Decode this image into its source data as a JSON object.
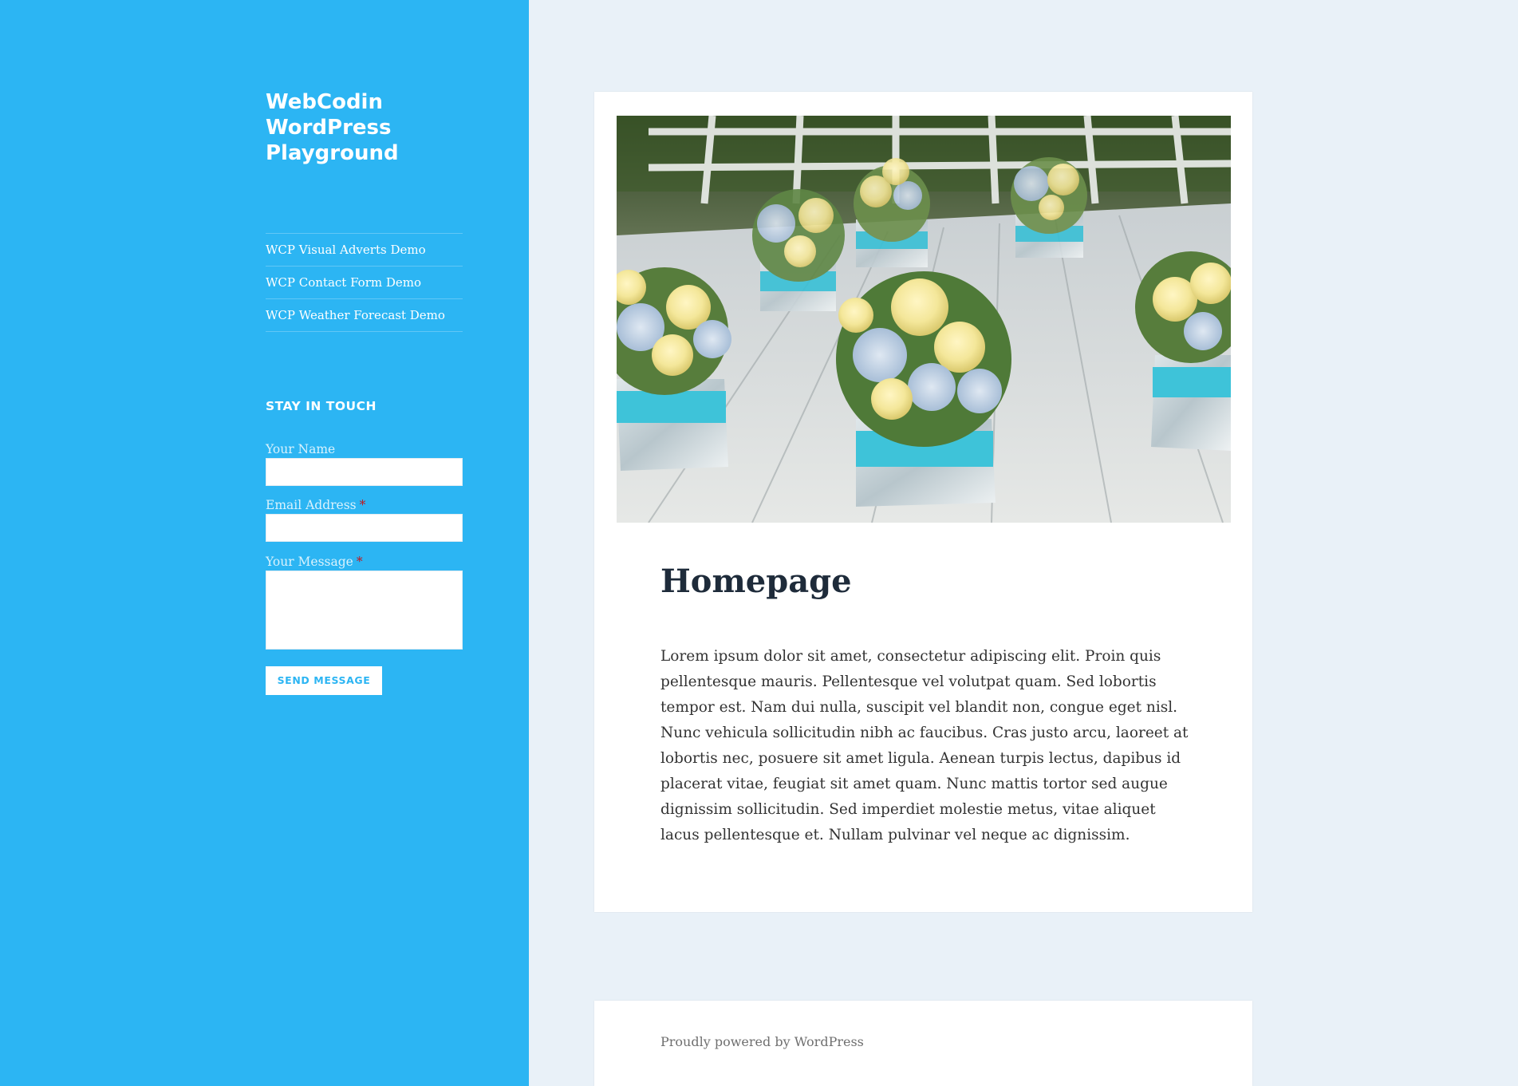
{
  "site": {
    "title_line1": "WebCodin",
    "title_line2": "WordPress",
    "title_line3": "Playground"
  },
  "nav": {
    "items": [
      {
        "label": "WCP Visual Adverts Demo"
      },
      {
        "label": "WCP Contact Form Demo"
      },
      {
        "label": "WCP Weather Forecast Demo"
      }
    ]
  },
  "contact_widget": {
    "title": "Stay in Touch",
    "name_label": "Your Name",
    "email_label": "Email Address",
    "message_label": "Your Message",
    "required_marker": "*",
    "name_value": "",
    "email_value": "",
    "message_value": "",
    "submit_label": "Send Message"
  },
  "article": {
    "title": "Homepage",
    "body": "Lorem ipsum dolor sit amet, consectetur adipiscing elit. Proin quis pellentesque mauris. Pellentesque vel volutpat quam. Sed lobortis tempor est. Nam dui nulla, suscipit vel blandit non, congue eget nisl. Nunc vehicula sollicitudin nibh ac faucibus. Cras justo arcu, laoreet at lobortis nec, posuere sit amet ligula. Aenean turpis lectus, dapibus id placerat vitae, feugiat sit amet quam. Nunc mattis tortor sed augue dignissim sollicitudin. Sed imperdiet molestie metus, vitae aliquet lacus pellentesque et. Nullam pulvinar vel neque ac dignissim."
  },
  "footer": {
    "text": "Proudly powered by WordPress"
  },
  "colors": {
    "sidebar": "#2cb5f3",
    "page_background": "#e9f1f8",
    "card": "#ffffff",
    "title_text": "#1e2b3a",
    "required": "#c4161c"
  }
}
